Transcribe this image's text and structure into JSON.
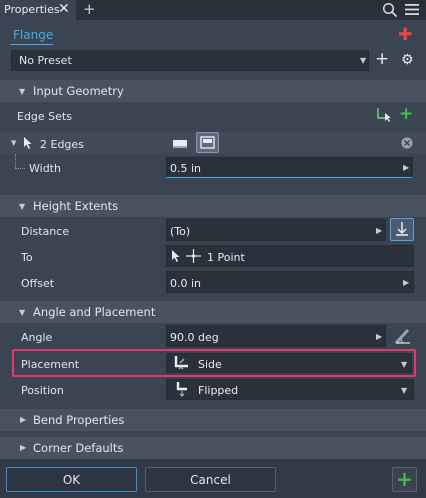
{
  "tab": {
    "title": "Properties"
  },
  "feature": {
    "name": "Flange"
  },
  "preset": {
    "value": "No Preset"
  },
  "sections": {
    "input_geometry": "Input Geometry",
    "height_extents": "Height Extents",
    "angle_placement": "Angle and Placement",
    "bend_properties": "Bend Properties",
    "corner_defaults": "Corner Defaults"
  },
  "input_geometry": {
    "edge_sets_label": "Edge Sets",
    "edges_label": "2 Edges",
    "width_label": "Width",
    "width_value": "0.5 in"
  },
  "height_extents": {
    "distance_label": "Distance",
    "distance_value": "(To)",
    "to_label": "To",
    "to_value": "1 Point",
    "offset_label": "Offset",
    "offset_value": "0.0 in"
  },
  "angle_placement": {
    "angle_label": "Angle",
    "angle_value": "90.0 deg",
    "placement_label": "Placement",
    "placement_value": "Side",
    "position_label": "Position",
    "position_value": "Flipped"
  },
  "buttons": {
    "ok": "OK",
    "cancel": "Cancel"
  },
  "colors": {
    "accent": "#4aa8e8",
    "highlight": "#e8356a",
    "add_green": "#3fbf4a",
    "add_red": "#e04848"
  }
}
